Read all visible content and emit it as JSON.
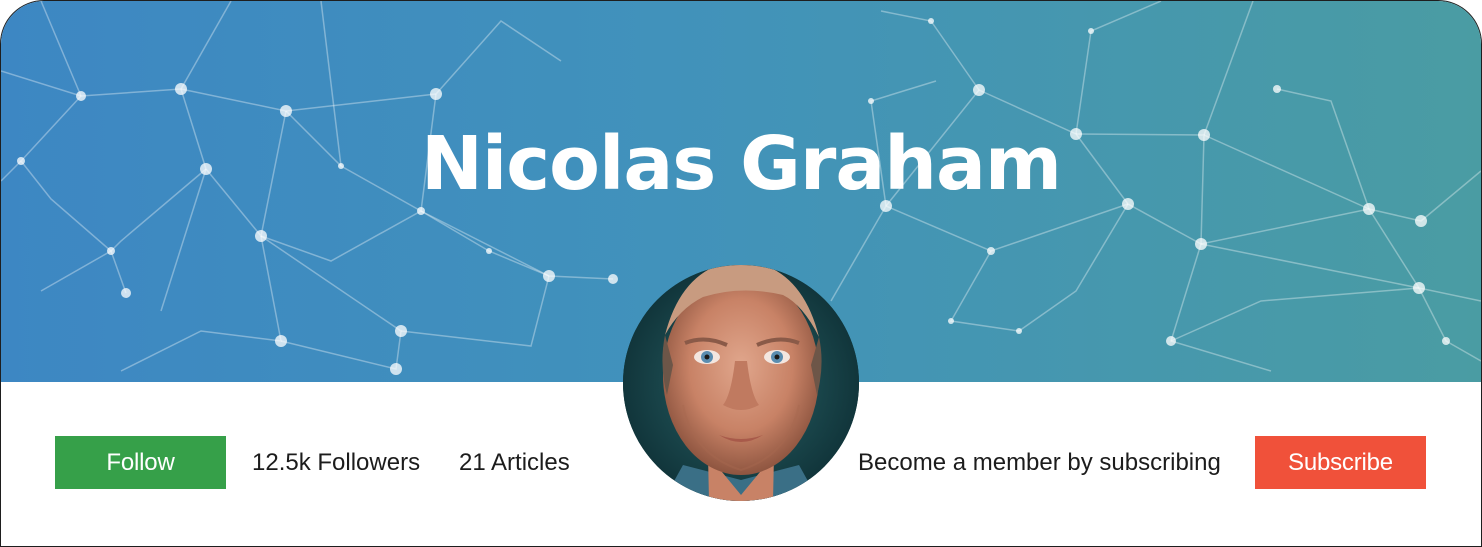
{
  "profile": {
    "name": "Nicolas Graham",
    "followers": "12.5k Followers",
    "articles": "21 Articles",
    "member_prompt": "Become a member by subscribing"
  },
  "actions": {
    "follow_label": "Follow",
    "subscribe_label": "Subscribe"
  },
  "colors": {
    "banner_start": "#3d87c3",
    "banner_end": "#4a9ca3",
    "follow_button": "#36a049",
    "subscribe_button": "#f0513a",
    "text": "#1c1c1c"
  },
  "icons": {
    "banner_pattern": "network-pattern",
    "avatar": "profile-photo"
  }
}
